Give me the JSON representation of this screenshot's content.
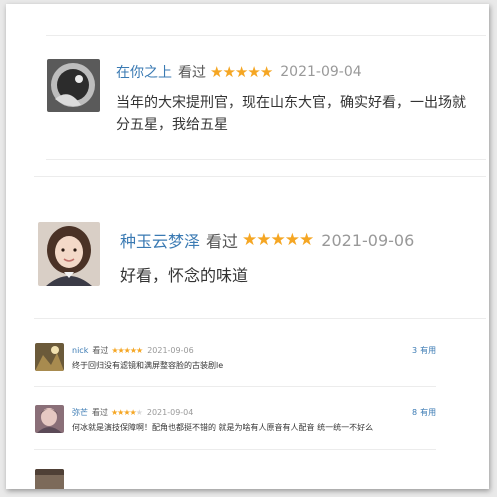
{
  "reviews": [
    {
      "user": "在你之上",
      "action": "看过",
      "rating": 5,
      "date": "2021-09-04",
      "comment_line1": "当年的大宋提刑官，现在山东大官，确实好看，一出场就",
      "comment_line2": "分五星，我给五星"
    },
    {
      "user": "种玉云梦泽",
      "action": "看过",
      "rating": 5,
      "date": "2021-09-06",
      "comment_line1": "好看，怀念的味道"
    },
    {
      "user": "nick",
      "action": "看过",
      "rating": 5,
      "date": "2021-09-06",
      "comment_line1": "终于回归没有滤镜和满屏整容脸的古装剧le",
      "useful_count": "3",
      "useful_label": "有用"
    },
    {
      "user": "弥芒",
      "action": "看过",
      "rating": 4,
      "date": "2021-09-04",
      "comment_line1": "何冰就是演技保障啊！配角也都挺不错的 就是为啥有人原音有人配音 统一统一不好么",
      "useful_count": "8",
      "useful_label": "有用"
    }
  ],
  "colors": {
    "username": "#3a7ab3",
    "star": "#f5a623",
    "date": "#999999",
    "text": "#333333"
  }
}
